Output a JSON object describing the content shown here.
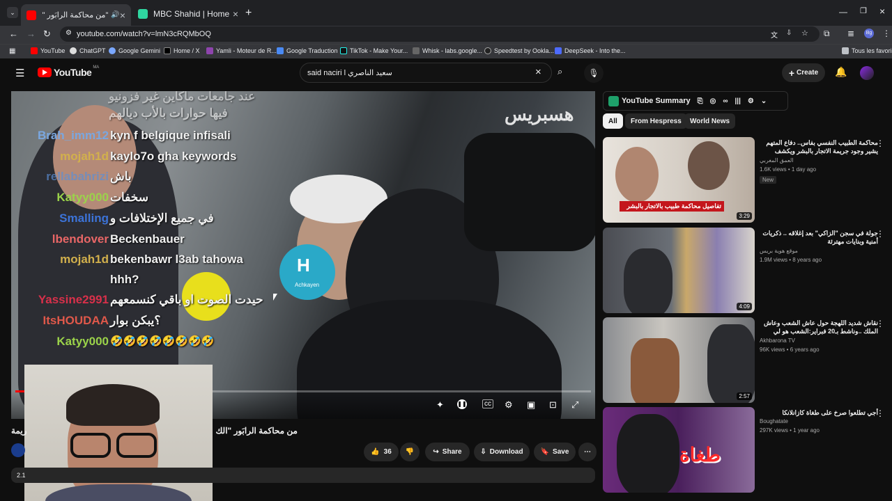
{
  "browser": {
    "tabs": [
      {
        "title": "\"من محاكمة الرابَور \"الكناوي"
      },
      {
        "title": "MBC Shahid | Home"
      }
    ],
    "url": "youtube.com/watch?v=lmN3cRQMbOQ",
    "bookmarks": [
      "YouTube",
      "ChatGPT",
      "Google Gemini",
      "Home / X",
      "Yamli - Moteur de R...",
      "Google Traduction",
      "TikTok - Make Your...",
      "Whisk - labs.google...",
      "Speedtest by Ookla...",
      "DeepSeek - Into the..."
    ],
    "all_bookmarks": "Tous les favoris"
  },
  "youtube": {
    "logo": "YouTube",
    "region": "MA",
    "search_value": "said naciri l سعيد الناصري",
    "create_label": "Create"
  },
  "video": {
    "watermark": "هسبريس",
    "chat": [
      {
        "user": "",
        "text": "عند جامعات ماكاين غير فزونيو"
      },
      {
        "user": "",
        "text": "فيها حوارات بالأب ديالهم"
      },
      {
        "user": "Brah_imm12",
        "text": "kyn f belgique infisali",
        "color": "#7aa7e0"
      },
      {
        "user": "mojah1d",
        "text": "kaylo7o gha keywords",
        "color": "#d2b04c"
      },
      {
        "user": "rellabahrizi",
        "text": "باش",
        "color": "#5b8fd6"
      },
      {
        "user": "Katyy000",
        "text": "سخفات",
        "color": "#9bd34a"
      },
      {
        "user": "Smalling",
        "text": "في جميع الإختلافات و",
        "color": "#3c73d8"
      },
      {
        "user": "lbendover",
        "text": "Beckenbauer",
        "color": "#e86666"
      },
      {
        "user": "mojah1d",
        "text": "bekenbawr l3ab tahowa",
        "color": "#d2b04c"
      },
      {
        "user": "",
        "text": "hhh?"
      },
      {
        "user": "Yassine2991",
        "text": "حيدت الصوت او باقي كنسمعهم",
        "color": "#d8304a"
      },
      {
        "user": "ItsHOUDAA",
        "text": "؟يبكن بوار",
        "color": "#e0584a"
      },
      {
        "user": "Katyy000",
        "text": "🤣🤣🤣🤣🤣🤣🤣🤣",
        "color": "#9bd34a"
      }
    ],
    "mic_labels": [
      "H",
      "Achkayen",
      "Hespress"
    ],
    "title": "من محاكمة الرابَور \"الك",
    "title_left": "ريمة",
    "likes": "36",
    "share_label": "Share",
    "download_label": "Download",
    "save_label": "Save",
    "views_prefix": "2.1"
  },
  "sidebar": {
    "summary_label": "YouTube Summary",
    "chips": [
      "All",
      "From Hespress",
      "World News"
    ],
    "videos": [
      {
        "title": "محاكمة الطبيب النفسي بفاس.. دفاع المتهم يشير وجود جريمة الاتجار بالبشر ويكشف تفاصيل جديدة في...",
        "channel": "العمق المغربي",
        "meta": "1.6K views • 1 day ago",
        "badge": "New",
        "duration": "3:29",
        "overlay": "تفاصيل محاكمة طبيب بالاتجار بالبشر"
      },
      {
        "title": "جولة في سجن \"الزاكي\" بعد إغلاقه .. ذكريات أمنية وبنايات مهترئة",
        "channel": "موقع هوية بريس",
        "meta": "1.9M views • 8 years ago",
        "badge": "",
        "duration": "4:09",
        "overlay": ""
      },
      {
        "title": "نقاش شديد اللهجة حول عاش الشعب وعاش الملك ..وناشط بـ20 فبراير:الشعب هو لي كيحمي الملك",
        "channel": "Akhbarona TV",
        "meta": "96K views • 6 years ago",
        "badge": "",
        "duration": "2:57",
        "overlay": ""
      },
      {
        "title": "أجي تطلعوا صرخ على طغاة كازانلانكا",
        "channel": "Boughatate",
        "meta": "297K views • 1 year ago",
        "badge": "",
        "duration": "",
        "overlay": "طغاة"
      }
    ]
  },
  "colors": {
    "accent": "#ff0000",
    "tab_active": "#35363a"
  }
}
